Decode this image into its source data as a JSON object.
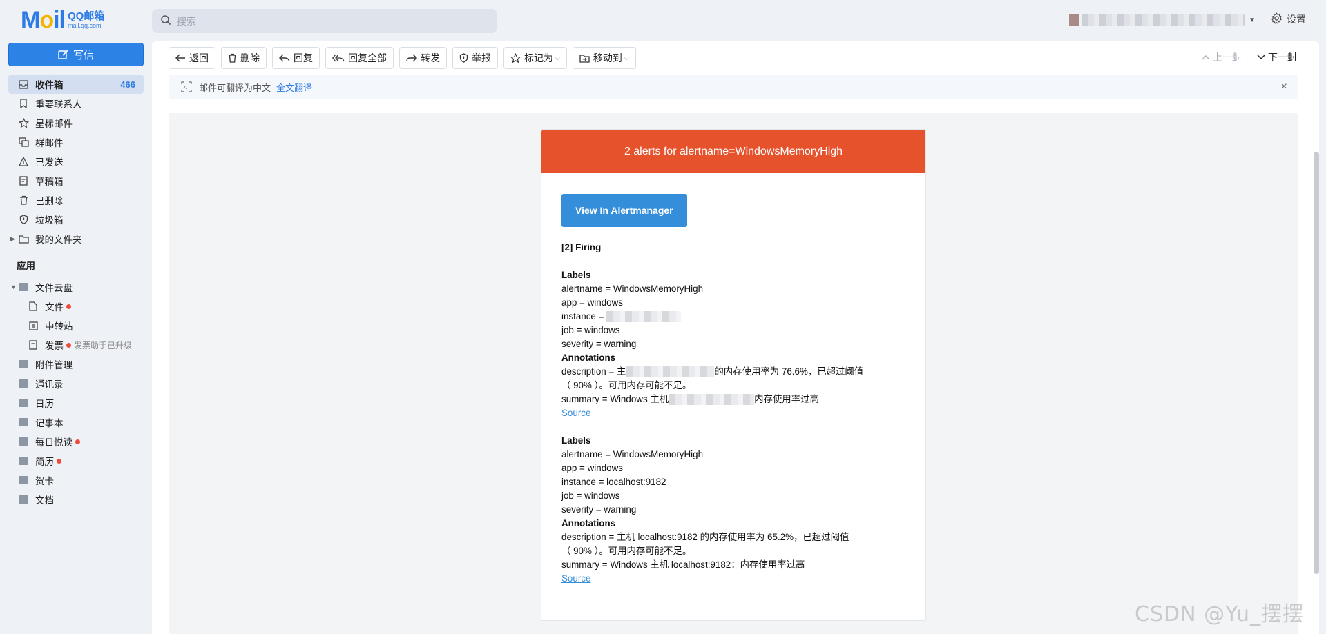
{
  "header": {
    "logo_text": "MAIL",
    "logo_brand": "QQ邮箱",
    "logo_domain": "mail.qq.com",
    "search_placeholder": "搜索",
    "settings_label": "设置"
  },
  "sidebar": {
    "compose_label": "写信",
    "items": [
      {
        "label": "收件箱",
        "count": "466"
      },
      {
        "label": "重要联系人"
      },
      {
        "label": "星标邮件"
      },
      {
        "label": "群邮件"
      },
      {
        "label": "已发送"
      },
      {
        "label": "草稿箱"
      },
      {
        "label": "已删除"
      },
      {
        "label": "垃圾箱"
      },
      {
        "label": "我的文件夹"
      }
    ],
    "apps_title": "应用",
    "apps": [
      {
        "label": "文件云盘"
      },
      {
        "label": "文件"
      },
      {
        "label": "中转站"
      },
      {
        "label": "发票",
        "hint": "发票助手已升级"
      },
      {
        "label": "附件管理"
      },
      {
        "label": "通讯录"
      },
      {
        "label": "日历"
      },
      {
        "label": "记事本"
      },
      {
        "label": "每日悦读"
      },
      {
        "label": "简历"
      },
      {
        "label": "贺卡"
      },
      {
        "label": "文档"
      }
    ]
  },
  "toolbar": {
    "back": "返回",
    "delete": "删除",
    "reply": "回复",
    "reply_all": "回复全部",
    "forward": "转发",
    "report": "举报",
    "mark_as": "标记为",
    "move_to": "移动到",
    "prev": "上一封",
    "next": "下一封"
  },
  "translate": {
    "text": "邮件可翻译为中文",
    "link": "全文翻译",
    "close": "×"
  },
  "email": {
    "title": "2 alerts for alertname=WindowsMemoryHigh",
    "button": "View In Alertmanager",
    "firing": "[2] Firing",
    "labels_heading": "Labels",
    "annotations_heading": "Annotations",
    "source_link": "Source",
    "alerts": [
      {
        "alertname": "alertname = WindowsMemoryHigh",
        "app": "app = windows",
        "instance": "instance = ",
        "job": "job = windows",
        "severity": "severity = warning",
        "description_prefix": "description = 主",
        "description_suffix": "的内存使用率为 76.6%，已超过阈值",
        "description_line2": "（ 90% ）。可用内存可能不足。",
        "summary_prefix": "summary = Windows 主机",
        "summary_suffix": "内存使用率过高"
      },
      {
        "alertname": "alertname = WindowsMemoryHigh",
        "app": "app = windows",
        "instance": "instance = localhost:9182",
        "job": "job = windows",
        "severity": "severity = warning",
        "description": "description = 主机 localhost:9182 的内存使用率为 65.2%，已超过阈值",
        "description_line2": "（ 90% ）。可用内存可能不足。",
        "summary": "summary = Windows 主机 localhost:9182：内存使用率过高"
      }
    ]
  },
  "watermark": "CSDN @Yu_摆摆"
}
